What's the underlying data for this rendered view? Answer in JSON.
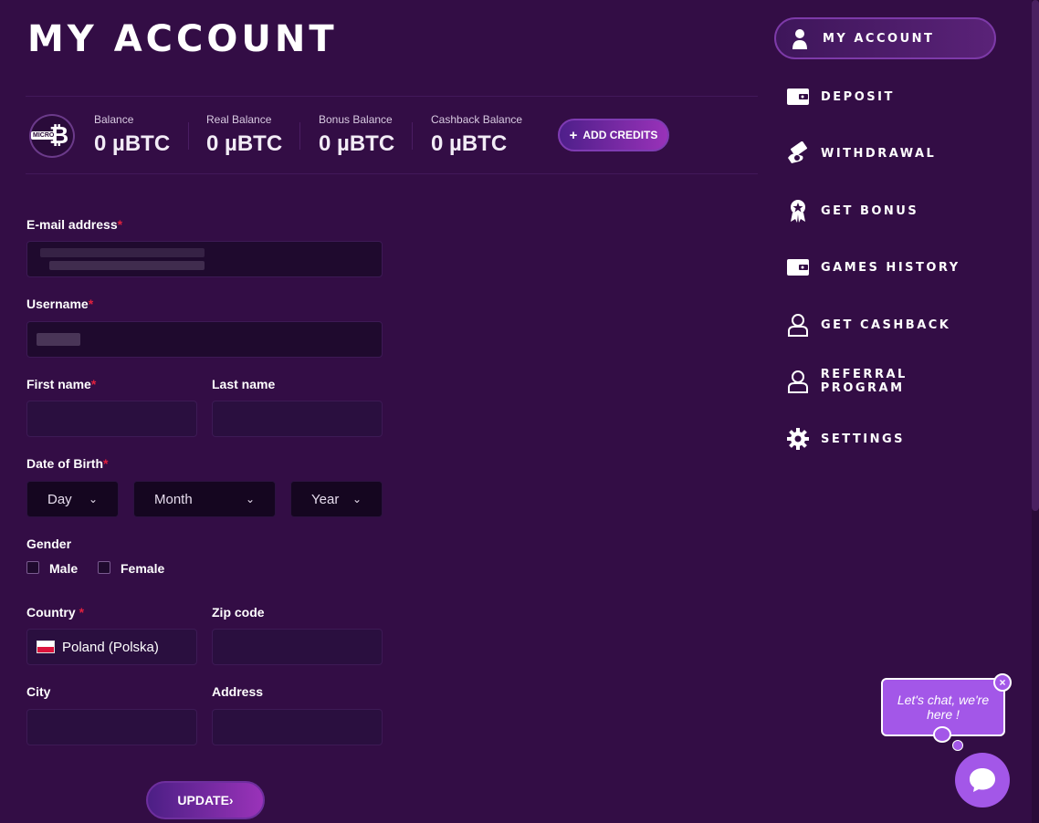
{
  "page": {
    "title": "MY ACCOUNT"
  },
  "balances": [
    {
      "label": "Balance",
      "value": "0 µBTC"
    },
    {
      "label": "Real Balance",
      "value": "0 µBTC"
    },
    {
      "label": "Bonus Balance",
      "value": "0 µBTC"
    },
    {
      "label": "Cashback Balance",
      "value": "0 µBTC"
    }
  ],
  "coin": {
    "badge": "MICRO",
    "symbol": "₿"
  },
  "add_credits": {
    "icon": "+",
    "label": "ADD CREDITS"
  },
  "form": {
    "email_label": "E-mail address",
    "username_label": "Username",
    "first_name_label": "First name",
    "last_name_label": "Last name",
    "dob_label": "Date of Birth",
    "dob_day": "Day",
    "dob_month": "Month",
    "dob_year": "Year",
    "gender_label": "Gender",
    "gender_male": "Male",
    "gender_female": "Female",
    "country_label": "Country",
    "country_value": "Poland (Polska)",
    "zip_label": "Zip code",
    "city_label": "City",
    "address_label": "Address",
    "required_mark": "*",
    "update_button": "UPDATE›"
  },
  "nav": {
    "items": [
      {
        "label": "MY ACCOUNT",
        "icon": "user-icon",
        "active": true
      },
      {
        "label": "DEPOSIT",
        "icon": "wallet-icon"
      },
      {
        "label": "WITHDRAWAL",
        "icon": "cash-hand-icon"
      },
      {
        "label": "GET BONUS",
        "icon": "award-ribbon-icon"
      },
      {
        "label": "GAMES HISTORY",
        "icon": "wallet-icon"
      },
      {
        "label": "GET CASHBACK",
        "icon": "user-outline-icon"
      },
      {
        "label": "REFERRAL PROGRAM",
        "icon": "user-outline-icon"
      },
      {
        "label": "SETTINGS",
        "icon": "gear-icon"
      }
    ]
  },
  "chat": {
    "message": "Let's chat, we're here !",
    "close": "×"
  },
  "colors": {
    "background": "#330d45",
    "accent": "#a357e8",
    "required": "#e0213d"
  }
}
